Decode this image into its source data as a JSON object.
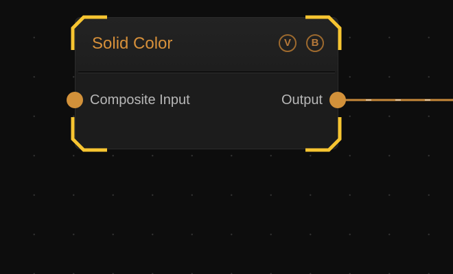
{
  "node": {
    "title": "Solid Color",
    "badges": [
      "V",
      "B"
    ],
    "inputs": [
      {
        "label": "Composite Input"
      }
    ],
    "outputs": [
      {
        "label": "Output"
      }
    ]
  },
  "colors": {
    "background": "#0d0d0d",
    "node_body": "#1c1c1c",
    "title": "#d7903a",
    "port": "#d2913a",
    "selection_bracket": "#f7c531",
    "wire": "#c8893a"
  },
  "state": {
    "selected": true
  }
}
